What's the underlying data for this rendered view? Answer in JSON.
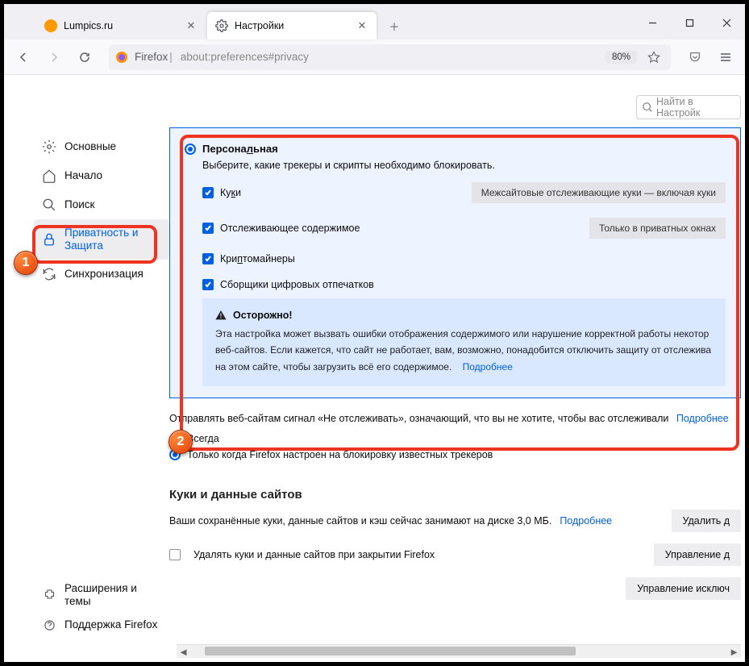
{
  "tabs": [
    {
      "title": "Lumpics.ru"
    },
    {
      "title": "Настройки"
    }
  ],
  "urlbar": {
    "identity": "Firefox",
    "address": "about:preferences#privacy",
    "zoom": "80%"
  },
  "search": {
    "placeholder": "Найти в Настройк"
  },
  "sidebar": {
    "items": [
      {
        "label": "Основные"
      },
      {
        "label": "Начало"
      },
      {
        "label": "Поиск"
      },
      {
        "label": "Приватность и Защита"
      },
      {
        "label": "Синхронизация"
      }
    ],
    "bottom": [
      {
        "label": "Расширения и темы"
      },
      {
        "label": "Поддержка Firefox"
      }
    ]
  },
  "customPanel": {
    "title": "Персональная",
    "subtitle": "Выберите, какие трекеры и скрипты необходимо блокировать.",
    "cookies": {
      "label": "Куки",
      "dropdown": "Межсайтовые отслеживающие куки — включая куки"
    },
    "tracking": {
      "label": "Отслеживающее содержимое",
      "dropdown": "Только в приватных окнах"
    },
    "miners": {
      "label": "Криптомайнеры"
    },
    "fp": {
      "label": "Сборщики цифровых отпечатков"
    },
    "warning": {
      "title": "Осторожно!",
      "text": "Эта настройка может вызвать ошибки отображения содержимого или нарушение корректной работы некотор веб-сайтов. Если кажется, что сайт не работает, вам, возможно, понадобится отключить защиту от отслежива на этом сайте, чтобы загрузить всё его содержимое.",
      "link": "Подробнее"
    }
  },
  "dnt": {
    "text": "Отправлять веб-сайтам сигнал «Не отслеживать», означающий, что вы не хотите, чтобы вас отслеживали",
    "more": "Подробнее",
    "always": "Всегда",
    "onlyWhen": "Только когда Firefox настроен на блокировку известных трекеров"
  },
  "cookies": {
    "heading": "Куки и данные сайтов",
    "info": "Ваши сохранённые куки, данные сайтов и кэш сейчас занимают на диске 3,0 МБ.",
    "more": "Подробнее",
    "clearBtn": "Удалить д",
    "clearOnClose": "Удалять куки и данные сайтов при закрытии Firefox",
    "manageBtn": "Управление д",
    "exceptBtn": "Управление исключ"
  }
}
